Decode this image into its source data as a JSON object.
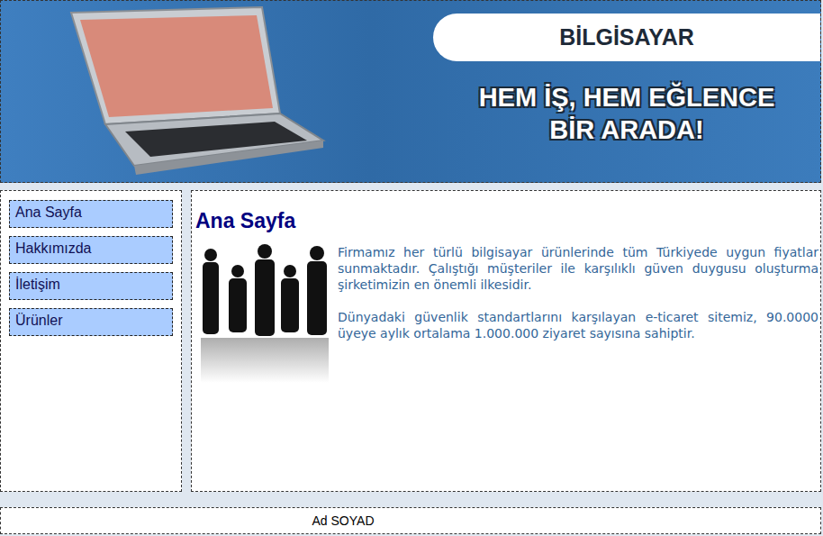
{
  "banner": {
    "title": "BİLGİSAYAR",
    "slogan": [
      "HEM İŞ, HEM EĞLENCE",
      "BİR ARADA!"
    ]
  },
  "sidebar": {
    "items": [
      {
        "label": "Ana Sayfa"
      },
      {
        "label": "Hakkımızda"
      },
      {
        "label": "İletişim"
      },
      {
        "label": "Ürünler"
      }
    ]
  },
  "content": {
    "title": "Ana Sayfa",
    "paragraphs": [
      "Firmamız her türlü bilgisayar ürünlerinde tüm Türkiyede uygun fiyatlar sunmaktadır. Çalıştığı müşteriler ile karşılıklı güven duygusu oluşturma şirketimizin en önemli ilkesidir.",
      "Dünyadaki güvenlik standartlarını karşılayan e-ticaret sitemiz, 90.0000 üyeye aylık ortalama 1.000.000 ziyaret sayısına sahiptir."
    ]
  },
  "footer": {
    "text": "Ad SOYAD"
  }
}
